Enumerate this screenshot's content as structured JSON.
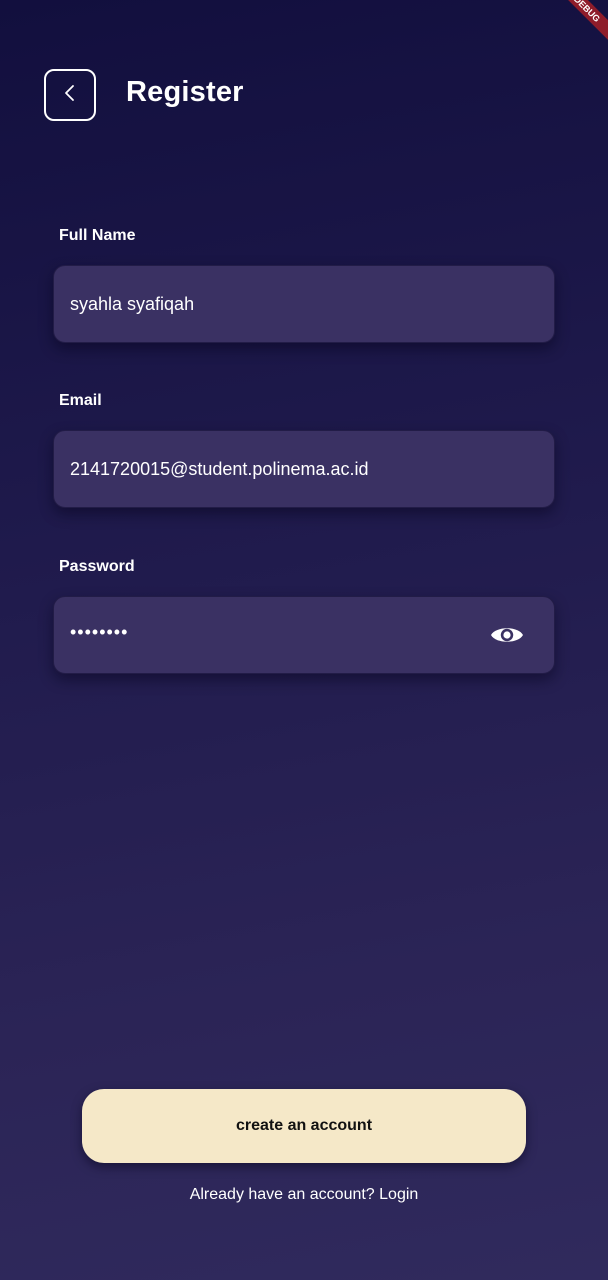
{
  "header": {
    "title": "Register",
    "back_icon": "chevron-left-icon"
  },
  "debug_banner": {
    "text": "DEBUG"
  },
  "form": {
    "full_name": {
      "label": "Full Name",
      "value": "syahla syafiqah"
    },
    "email": {
      "label": "Email",
      "value": "2141720015@student.polinema.ac.id"
    },
    "password": {
      "label": "Password",
      "masked_value": "••••••••",
      "toggle_icon": "eye-icon"
    }
  },
  "actions": {
    "create_label": "create an account",
    "login_prompt": "Already have an account? Login"
  },
  "colors": {
    "background_top": "#120f3e",
    "background_bottom": "#302a5d",
    "field_fill": "#3a3163",
    "button_fill": "#f5e8c8",
    "debug_ribbon": "#8e1c2a"
  }
}
